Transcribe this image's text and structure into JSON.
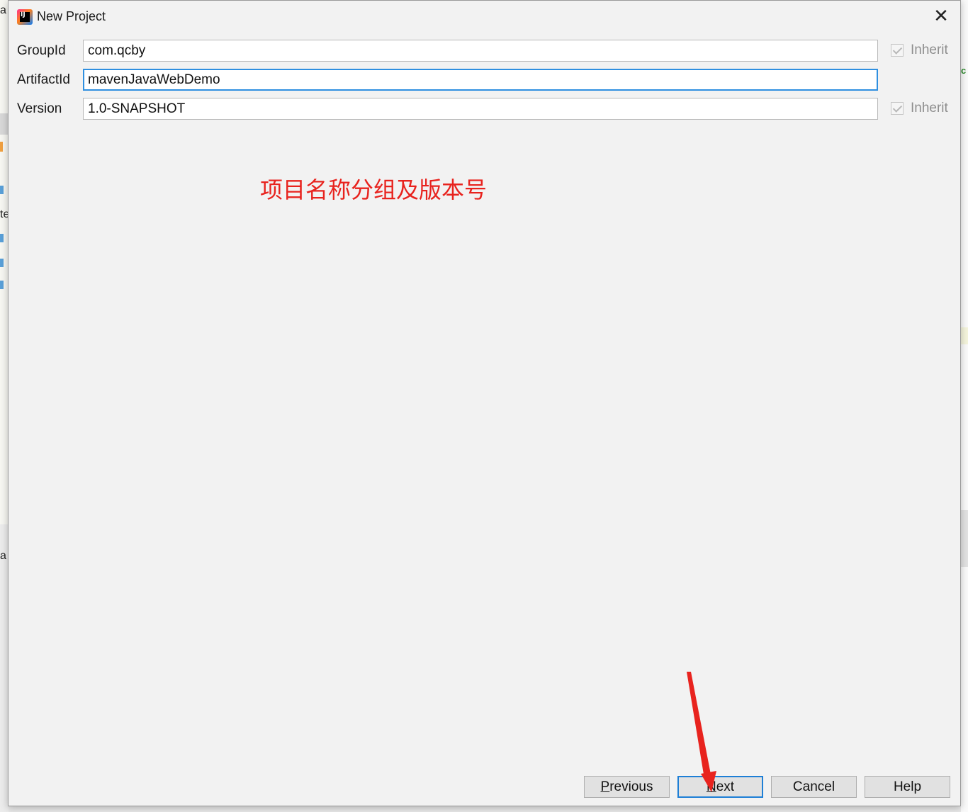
{
  "background": {
    "left_fragments": [
      "a",
      "te",
      "a"
    ],
    "right_fragment": "c"
  },
  "dialog": {
    "title": "New Project",
    "close_glyph": "✕",
    "app_icon_text": "IJ",
    "app_icon": "intellij-idea-icon"
  },
  "form": {
    "groupId": {
      "label": "GroupId",
      "value": "com.qcby",
      "inherit_label": "Inherit",
      "inherit_checked": true
    },
    "artifactId": {
      "label": "ArtifactId",
      "value": "mavenJavaWebDemo"
    },
    "version": {
      "label": "Version",
      "value": "1.0-SNAPSHOT",
      "inherit_label": "Inherit",
      "inherit_checked": true
    }
  },
  "annotation": {
    "text": "项目名称分组及版本号",
    "color": "#e8231e"
  },
  "buttons": {
    "previous": {
      "mnemonic": "P",
      "rest": "revious"
    },
    "next": {
      "mnemonic": "N",
      "rest": "ext"
    },
    "cancel": {
      "label": "Cancel"
    },
    "help": {
      "label": "Help"
    }
  },
  "colors": {
    "focus_border": "#2f8fe0",
    "default_button_border": "#1e7fd6",
    "arrow": "#e8231e"
  }
}
